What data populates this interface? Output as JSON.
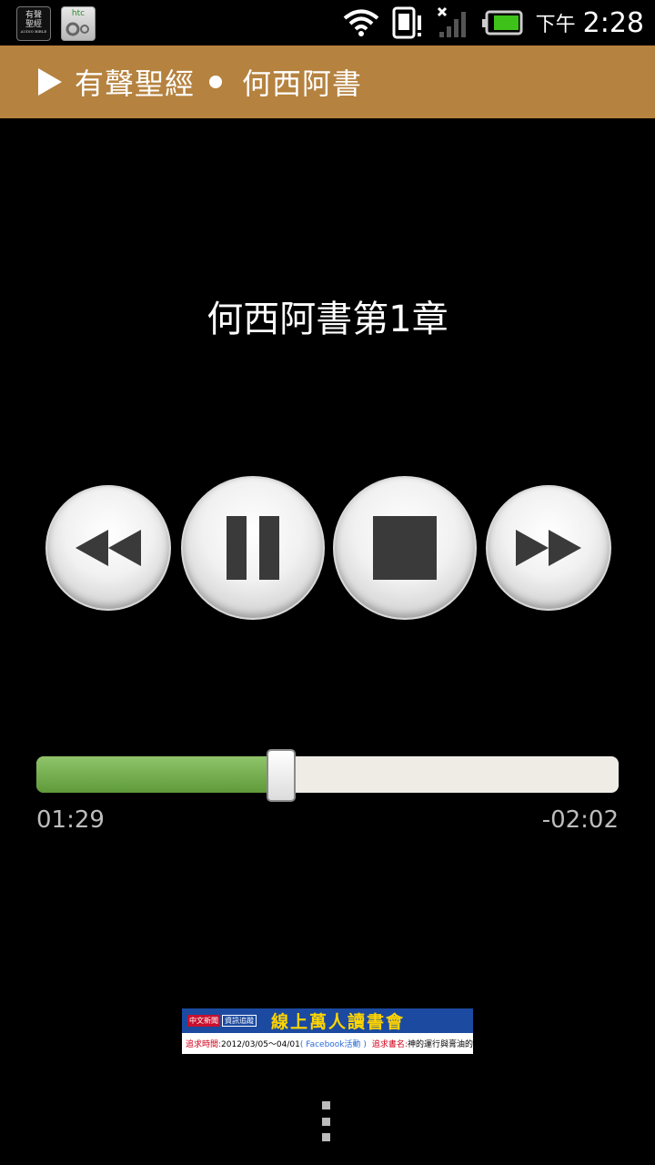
{
  "status_bar": {
    "ampm": "下午",
    "time": "2:28",
    "icons": [
      "audio-bible-app-icon",
      "htc-settings-icon",
      "wifi-icon",
      "sim-alert-icon",
      "no-signal-icon",
      "battery-icon"
    ],
    "app_icon_text": [
      "有聲",
      "聖經",
      "AUDIO BIBLE"
    ],
    "htc_text": "htc"
  },
  "header": {
    "app_name": "有聲聖經",
    "book_name": "何西阿書"
  },
  "player": {
    "chapter_title": "何西阿書第1章",
    "buttons": [
      "rewind",
      "pause",
      "stop",
      "fast-forward"
    ],
    "progress": 0.42,
    "elapsed": "01:29",
    "remaining": "-02:02"
  },
  "ad": {
    "tag1": "中文新聞",
    "tag2": "資訊追蹤",
    "headline": "線上萬人讀書會",
    "line_label1": "追求時間:",
    "line_date": "2012/03/05～04/01",
    "line_fb": "( Facebook活動 )",
    "line_label2": "追求書名:",
    "line_book": "神的運行與膏油的塗抹"
  },
  "colors": {
    "header_bg": "#b5823f",
    "progress_fill": "#6fae47",
    "progress_track": "#efece6"
  }
}
